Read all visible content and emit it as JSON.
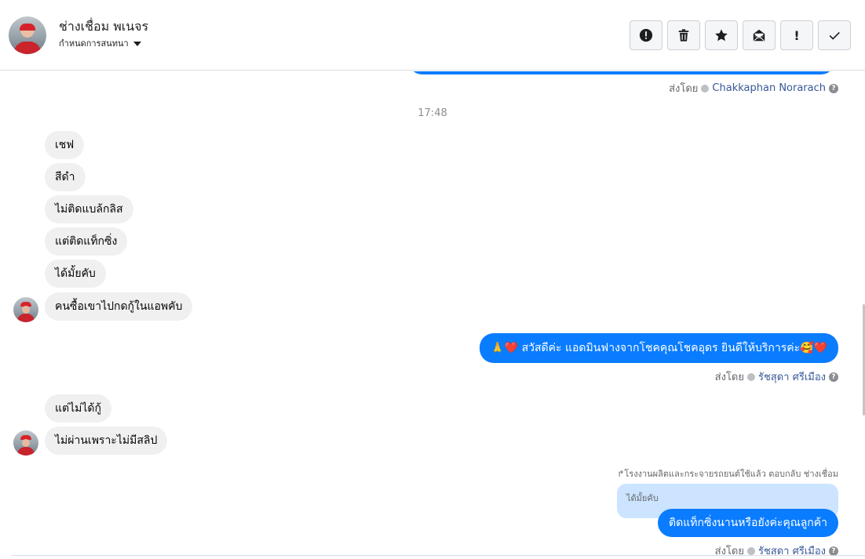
{
  "header": {
    "contact_name": "ช่างเชื่อม พเนจร",
    "assign_label": "กำหนดการสนทนา",
    "toolbar": [
      {
        "name": "report-spam-button",
        "icon": "alert-circle-icon"
      },
      {
        "name": "delete-button",
        "icon": "trash-icon"
      },
      {
        "name": "star-button",
        "icon": "star-icon"
      },
      {
        "name": "mark-unread-button",
        "icon": "envelope-open-icon"
      },
      {
        "name": "priority-button",
        "label": "!"
      },
      {
        "name": "done-button",
        "icon": "check-icon"
      }
    ]
  },
  "chat": {
    "first_sent_by": {
      "prefix": "ส่งโดย",
      "agent": "Chakkaphan Norarach"
    },
    "time_separator": "17:48",
    "incoming_group_1": [
      "เชฟ",
      "สีดำ",
      "ไม่ติดแบล้กลิส",
      "แต่ติดแท็กซิ่ง",
      "ได้มั้ยคับ",
      "คนซื้อเขาไปกดกู้ในแอพคับ"
    ],
    "outgoing_1": {
      "text": "🙏❤️ สวัสดีค่ะ แอดมินฟางจากโชคคุณโชคอุดร ยินดีให้บริการค่ะ🥰❤️",
      "sent_by_prefix": "ส่งโดย",
      "agent": "รัชสุดา ศรีเมือง"
    },
    "incoming_group_2": [
      "แต่ไม่ได้กู้",
      "ไม่ผ่านเพราะไม่มีสลิป"
    ],
    "reply_note": "↱โรงงานผลิตและกระจายรถยนต์ใช้แล้ว ตอบกลับ ช่างเชื่อม",
    "quoted_text": "ได้มั้ยคับ",
    "outgoing_2": {
      "text": "ติดแท็กซิ่งนานหรือยังค่ะคุณลูกค้า",
      "sent_by_prefix": "ส่งโดย",
      "agent": "รัชสุดา ศรีเมือง"
    }
  },
  "colors": {
    "outgoing_bubble": "#0a7cff",
    "incoming_bubble": "#f0f0f0",
    "quoted_bubble": "#cce4ff",
    "agent_link": "#385898"
  }
}
